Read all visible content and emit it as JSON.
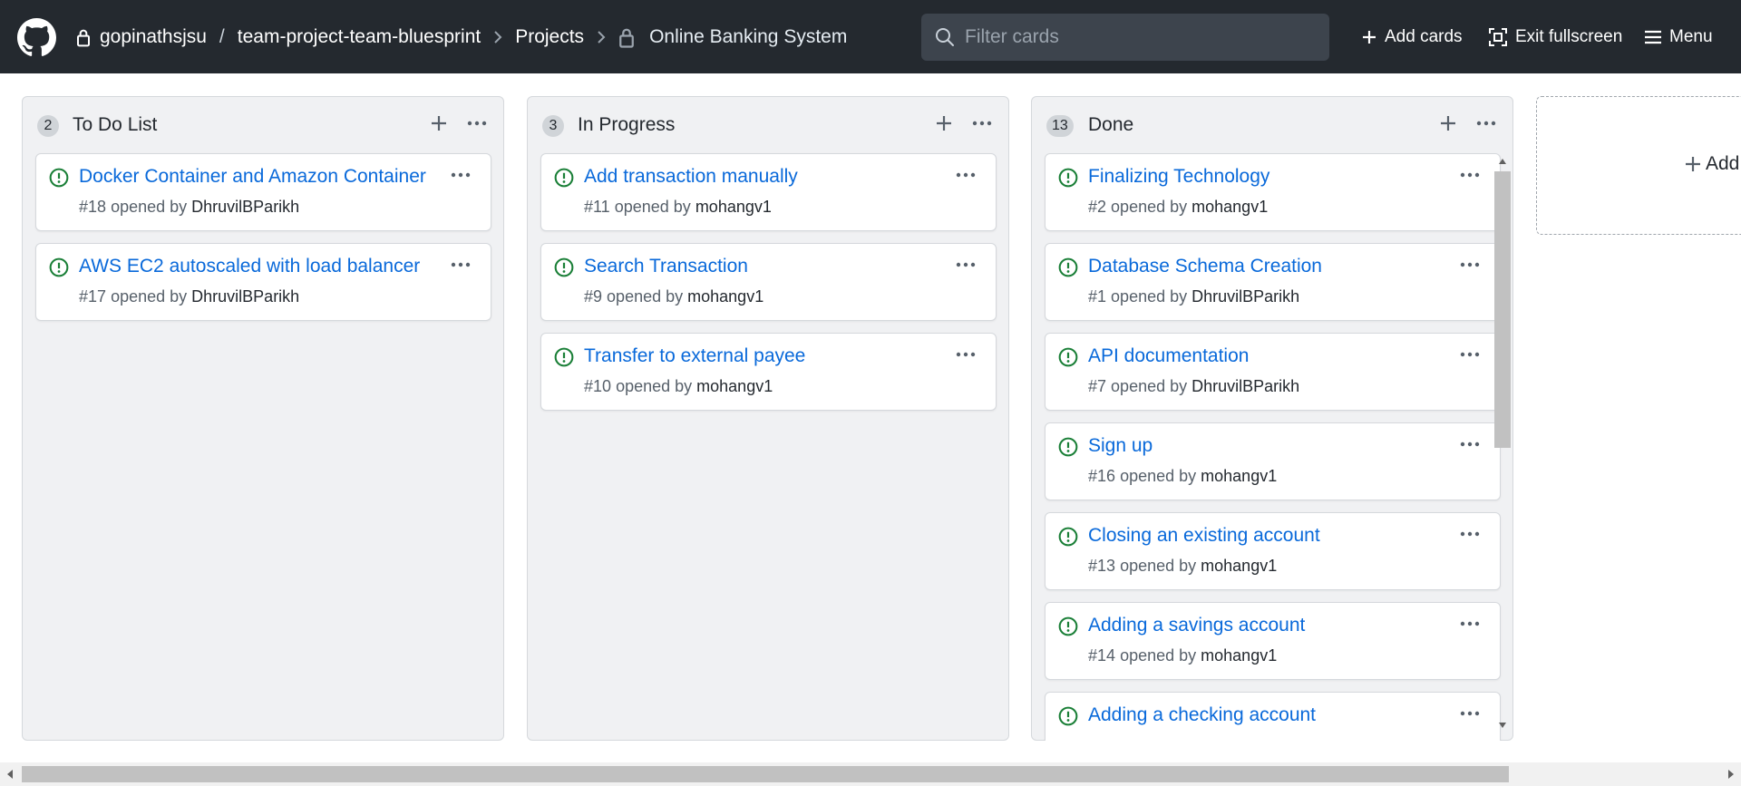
{
  "header": {
    "owner": "gopinathsjsu",
    "separator": "/",
    "repo": "team-project-team-bluesprint",
    "projects": "Projects",
    "project_title": "Online Banking System",
    "filter_placeholder": "Filter cards",
    "add_cards": "Add cards",
    "exit_fullscreen": "Exit fullscreen",
    "menu": "Menu"
  },
  "columns": [
    {
      "count": "2",
      "name": "To Do List",
      "cards": [
        {
          "title": "Docker Container and Amazon Container",
          "number": "#18",
          "opened_by": "opened by",
          "author": "DhruvilBParikh"
        },
        {
          "title": "AWS EC2 autoscaled with load balancer",
          "number": "#17",
          "opened_by": "opened by",
          "author": "DhruvilBParikh"
        }
      ]
    },
    {
      "count": "3",
      "name": "In Progress",
      "cards": [
        {
          "title": "Add transaction manually",
          "number": "#11",
          "opened_by": "opened by",
          "author": "mohangv1"
        },
        {
          "title": "Search Transaction",
          "number": "#9",
          "opened_by": "opened by",
          "author": "mohangv1"
        },
        {
          "title": "Transfer to external payee",
          "number": "#10",
          "opened_by": "opened by",
          "author": "mohangv1"
        }
      ]
    },
    {
      "count": "13",
      "name": "Done",
      "cards": [
        {
          "title": "Finalizing Technology",
          "number": "#2",
          "opened_by": "opened by",
          "author": "mohangv1"
        },
        {
          "title": "Database Schema Creation",
          "number": "#1",
          "opened_by": "opened by",
          "author": "DhruvilBParikh"
        },
        {
          "title": "API documentation",
          "number": "#7",
          "opened_by": "opened by",
          "author": "DhruvilBParikh"
        },
        {
          "title": "Sign up",
          "number": "#16",
          "opened_by": "opened by",
          "author": "mohangv1"
        },
        {
          "title": "Closing an existing account",
          "number": "#13",
          "opened_by": "opened by",
          "author": "mohangv1"
        },
        {
          "title": "Adding a savings account",
          "number": "#14",
          "opened_by": "opened by",
          "author": "mohangv1"
        },
        {
          "title": "Adding a checking account",
          "number": "",
          "opened_by": "",
          "author": ""
        }
      ]
    }
  ],
  "add_column_label": "Add",
  "icons": {
    "logo": "github-mark-icon",
    "lock": "lock-icon",
    "chevron": "chevron-right-icon",
    "search": "search-icon",
    "plus": "plus-icon",
    "fullscreen": "screen-normal-icon",
    "menu": "hamburger-icon",
    "issue": "issue-opened-icon",
    "kebab": "kebab-horizontal-icon"
  },
  "colors": {
    "header_bg": "#24292f",
    "link_blue": "#0969da",
    "issue_green": "#1a7f37",
    "column_bg": "#f0f1f3"
  }
}
